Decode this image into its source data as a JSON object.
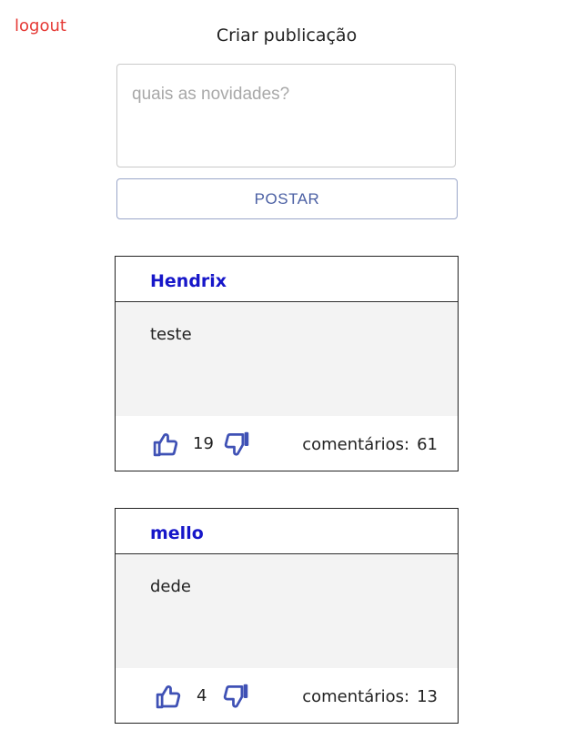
{
  "header": {
    "logout_label": "logout",
    "title": "Criar publicação"
  },
  "composer": {
    "placeholder": "quais as novidades?",
    "value": "",
    "post_button_label": "POSTAR"
  },
  "colors": {
    "logout": "#e53935",
    "author": "#1616c9",
    "icon": "#3f51b5",
    "button_text": "#4a5fa3"
  },
  "posts": [
    {
      "author": "Hendrix",
      "content": "teste",
      "likes": "19",
      "comments_label": "comentários:",
      "comments_count": "61",
      "like_icon": "thumbs-up-icon",
      "dislike_icon": "thumbs-down-icon"
    },
    {
      "author": "mello",
      "content": "dede",
      "likes": "4",
      "comments_label": "comentários:",
      "comments_count": "13",
      "like_icon": "thumbs-up-icon",
      "dislike_icon": "thumbs-down-icon"
    }
  ]
}
